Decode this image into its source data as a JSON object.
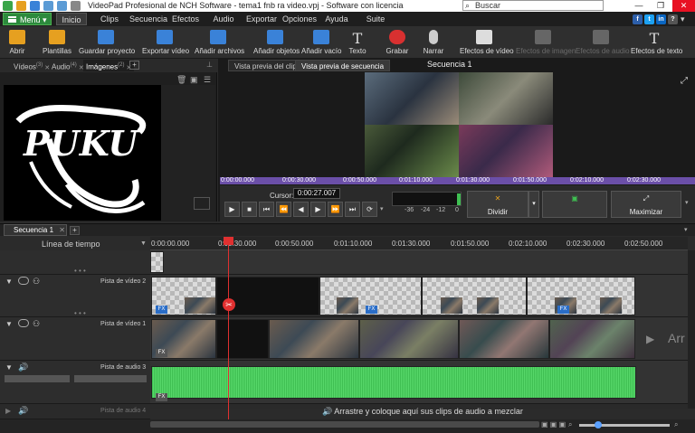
{
  "window": {
    "title": "VideoPad Profesional de NCH Software - tema1 fnb ra video.vpj - Software con licencia",
    "search_placeholder": "Buscar",
    "minimize": "—",
    "maximize": "❐",
    "close": "✕"
  },
  "menu": {
    "menu_button": "Menú",
    "items": [
      "Inicio",
      "Clips",
      "Secuencia",
      "Efectos",
      "Audio",
      "Exportar",
      "Opciones",
      "Ayuda",
      "Suite NCH"
    ]
  },
  "toolbar": [
    {
      "label": "Abrir",
      "icon": "folder-icon",
      "color": "#e6a020"
    },
    {
      "label": "Plantillas",
      "icon": "templates-icon",
      "color": "#e6a020"
    },
    {
      "label": "Guardar proyecto",
      "icon": "save-icon",
      "color": "#3a82d8"
    },
    {
      "label": "Exportar vídeo",
      "icon": "export-video-icon",
      "color": "#3a82d8"
    },
    {
      "label": "Añadir archivos",
      "icon": "add-files-icon",
      "color": "#3a82d8"
    },
    {
      "label": "Añadir objetos",
      "icon": "add-objects-icon",
      "color": "#3a82d8"
    },
    {
      "label": "Añadir vacío",
      "icon": "add-blank-icon",
      "color": "#3a82d8"
    },
    {
      "label": "Texto",
      "icon": "text-icon",
      "color": "#dddddd"
    },
    {
      "label": "Grabar",
      "icon": "record-icon",
      "color": "#d83030"
    },
    {
      "label": "Narrar",
      "icon": "microphone-icon",
      "color": "#cccccc"
    },
    {
      "label": "Efectos de vídeo",
      "icon": "video-effects-icon",
      "color": "#dddddd"
    },
    {
      "label": "Efectos de imagen",
      "icon": "image-effects-icon",
      "color": "#666666"
    },
    {
      "label": "Efectos de audio",
      "icon": "audio-effects-icon",
      "color": "#666666"
    },
    {
      "label": "Efectos de texto",
      "icon": "text-effects-icon",
      "color": "#dddddd"
    }
  ],
  "bin": {
    "tabs": [
      {
        "label": "Vídeos",
        "count": "(3)"
      },
      {
        "label": "Audio",
        "count": "(4)"
      },
      {
        "label": "Imágenes",
        "count": "(2)"
      }
    ],
    "add_tab": "+",
    "thumbnail_text": "PUKU"
  },
  "preview": {
    "tabs": [
      "Vista previa del clip",
      "Vista previa de secuencia"
    ],
    "title": "Secuencia 1",
    "ruler_times": [
      "0:00:00.000",
      "0:00:30.000",
      "0:00:50.000",
      "0:01:10.000",
      "0:01:30.000",
      "0:01:50.000",
      "0:02:10.000",
      "0:02:30.000"
    ],
    "cursor_label": "Cursor:",
    "cursor_value": "0:00:27.007",
    "vu_labels": [
      "-36",
      "-24",
      "-12",
      "0"
    ],
    "split_label": "Dividir",
    "maximize_label": "Maximizar"
  },
  "timeline": {
    "tab": "Secuencia 1",
    "header_label": "Línea de tiempo",
    "ruler_times": [
      "0:00:00.000",
      "0:00:30.000",
      "0:00:50.000",
      "0:01:10.000",
      "0:01:30.000",
      "0:01:50.000",
      "0:02:10.000",
      "0:02:30.000",
      "0:02:50.000"
    ],
    "tracks": {
      "video2": "Pista de vídeo 2",
      "video1": "Pista de vídeo 1",
      "audio3": "Pista de audio 3",
      "audio4": "Pista de audio 4"
    },
    "fx_label": "FX",
    "drag_message": "Arrastre y coloque aquí sus clips de audio a mezclar",
    "side_label": "Arr"
  }
}
